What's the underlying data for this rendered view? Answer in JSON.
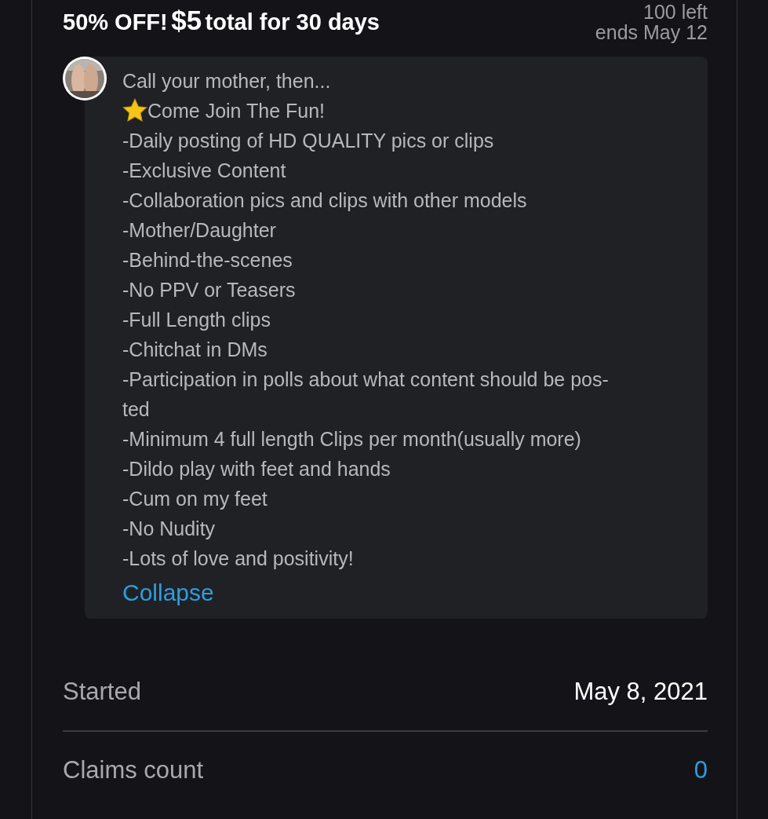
{
  "promo": {
    "title_prefix": "50% OFF!",
    "price": "$5",
    "title_suffix": "total for 30 days",
    "remaining": "100 left",
    "ends": "ends May 12"
  },
  "description": {
    "lines": [
      {
        "kind": "text",
        "text": "Call your mother, then..."
      },
      {
        "kind": "star",
        "text": "Come Join The Fun!"
      },
      {
        "kind": "text",
        "text": "-Daily posting of HD QUALITY pics or clips"
      },
      {
        "kind": "text",
        "text": "-Exclusive Content"
      },
      {
        "kind": "text",
        "text": "-Collaboration pics and clips with other models"
      },
      {
        "kind": "text",
        "text": "-Mother/Daughter"
      },
      {
        "kind": "text",
        "text": "-Behind-the-scenes"
      },
      {
        "kind": "text",
        "text": "-No PPV or Teasers"
      },
      {
        "kind": "text",
        "text": "-Full Length clips"
      },
      {
        "kind": "text",
        "text": "-Chitchat in DMs"
      },
      {
        "kind": "text",
        "text": "-Participation in polls about what content should be pos-"
      },
      {
        "kind": "text",
        "text": "ted"
      },
      {
        "kind": "text",
        "text": "-Minimum 4 full length Clips per month(usually more)"
      },
      {
        "kind": "text",
        "text": "-Dildo play with feet and hands"
      },
      {
        "kind": "text",
        "text": "-Cum on my feet"
      },
      {
        "kind": "text",
        "text": "-No Nudity"
      },
      {
        "kind": "text",
        "text": "-Lots of love and positivity!"
      }
    ],
    "collapse": "Collapse"
  },
  "stats": [
    {
      "label": "Started",
      "value": "May 8, 2021",
      "kind": "text"
    },
    {
      "label": "Claims count",
      "value": "0",
      "kind": "link"
    }
  ]
}
